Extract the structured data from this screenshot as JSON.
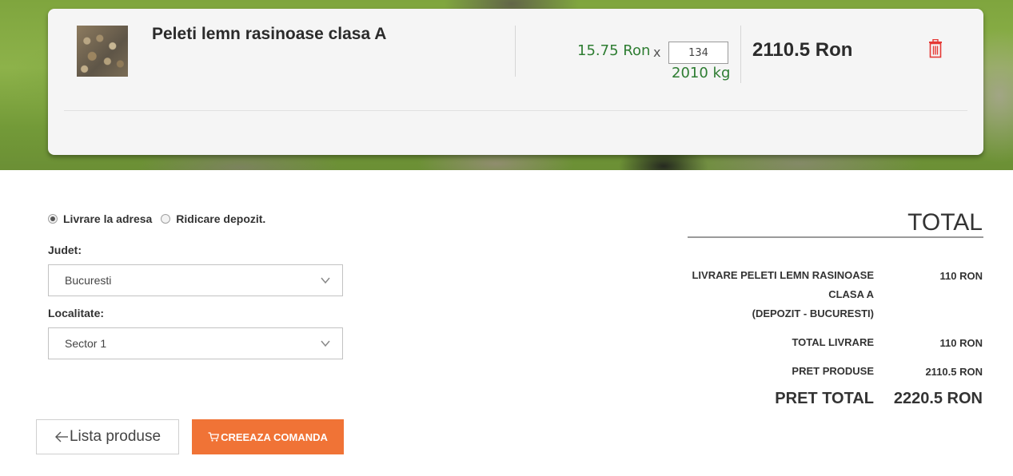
{
  "cart": {
    "item": {
      "name": "Peleti lemn rasinoase clasa A",
      "unit_price": "15.75 Ron",
      "times": "x",
      "quantity": "134",
      "weight": "2010 kg",
      "line_total": "2110.5 Ron"
    }
  },
  "delivery": {
    "options": [
      {
        "label": "Livrare la adresa",
        "selected": true
      },
      {
        "label": "Ridicare depozit.",
        "selected": false
      }
    ],
    "county_label": "Judet:",
    "county_value": "Bucuresti",
    "locality_label": "Localitate:",
    "locality_value": "Sector 1"
  },
  "actions": {
    "back_label": "Lista produse",
    "create_order_label": "CREEAZA COMANDA"
  },
  "totals": {
    "heading": "TOTAL",
    "rows": [
      {
        "label_line1": "LIVRARE PELETI LEMN RASINOASE",
        "label_line2": "CLASA A",
        "label_line3": "(DEPOZIT - BUCURESTI)",
        "value": "110 RON"
      },
      {
        "label": "TOTAL LIVRARE",
        "value": "110 RON"
      },
      {
        "label": "PRET PRODUSE",
        "value": "2110.5 RON"
      }
    ],
    "grand_label": "PRET TOTAL",
    "grand_value": "2220.5 RON"
  },
  "colors": {
    "accent_orange": "#f07336",
    "price_green": "#2e7d32",
    "delete_red": "#e53935"
  },
  "icons": {
    "delete": "trash-icon",
    "back": "arrow-left-icon",
    "order": "cart-icon",
    "select": "chevron-down-icon"
  }
}
